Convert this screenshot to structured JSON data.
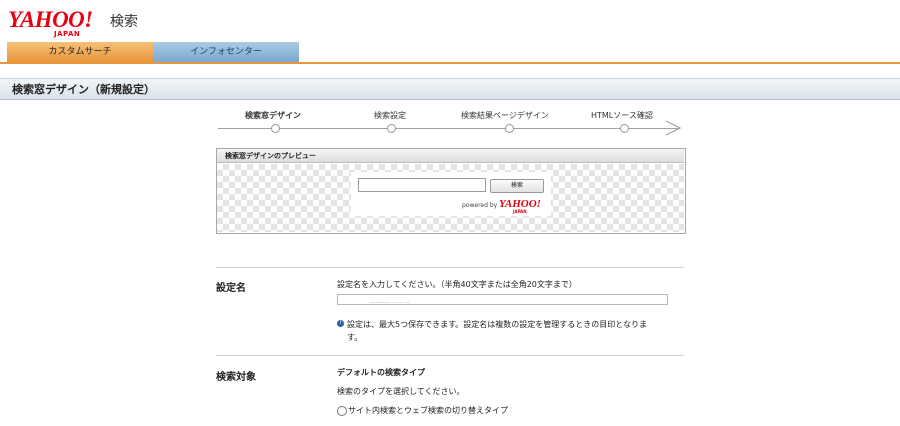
{
  "header": {
    "logo_text": "YAHOO!",
    "logo_sub": "JAPAN",
    "logo_suffix": "検索",
    "tabs": [
      {
        "label": "カスタムサーチ"
      },
      {
        "label": "インフォセンター"
      }
    ]
  },
  "page_title": "検索窓デザイン（新規設定）",
  "steps": [
    {
      "label": "検索窓デザイン",
      "active": true
    },
    {
      "label": "検索設定",
      "active": false
    },
    {
      "label": "検索結果ページデザイン",
      "active": false
    },
    {
      "label": "HTMLソース確認",
      "active": false
    }
  ],
  "preview": {
    "heading": "検索窓デザインのプレビュー",
    "search_button": "検索",
    "powered_by": "powered by",
    "logo_text": "YAHOO!",
    "logo_sub": "JAPAN"
  },
  "settings_name": {
    "label": "設定名",
    "instruction": "設定名を入力してください。（半角40文字または全角20文字まで）",
    "input_value": "＿＿＿＿ ＿ ＿ ＿",
    "info_icon": "info-icon",
    "note_line1": "設定は、最大5つ保存できます。設定名は複数の設定を管理するときの目印となりま",
    "note_line2": "す。"
  },
  "search_target": {
    "label": "検索対象",
    "subheading": "デフォルトの検索タイプ",
    "instruction": "検索のタイプを選択してください。",
    "option1": "サイト内検索とウェブ検索の切り替えタイプ"
  },
  "colors": {
    "brand_red": "#e60012",
    "tab_orange": "#e9963a",
    "tab_blue": "#7aa9cf"
  }
}
